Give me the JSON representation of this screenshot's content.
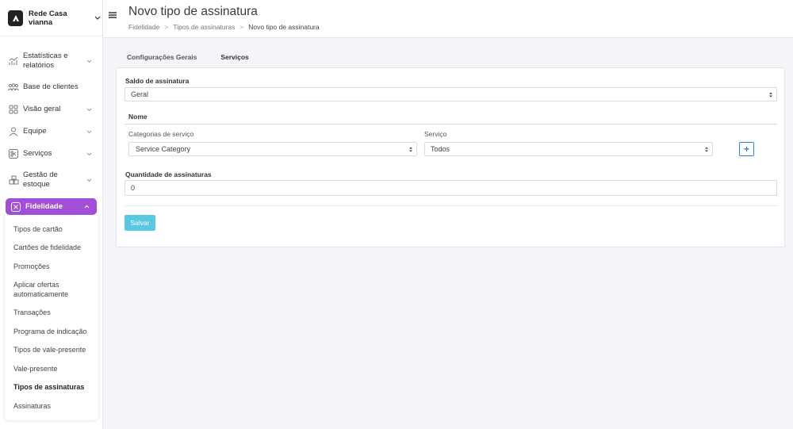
{
  "sidebar": {
    "brand": "Rede Casa vianna",
    "items": [
      {
        "label": "Estatísticas e relatórios"
      },
      {
        "label": "Base de clientes"
      },
      {
        "label": "Visão geral"
      },
      {
        "label": "Equipe"
      },
      {
        "label": "Serviços"
      },
      {
        "label": "Gestão de estoque"
      },
      {
        "label": "Fidelidade"
      }
    ],
    "submenu": [
      "Tipos de cartão",
      "Cartões de fidelidade",
      "Promoções",
      "Aplicar ofertas automaticamente",
      "Transações",
      "Programa de indicação",
      "Tipos de vale-presente",
      "Vale-presente",
      "Tipos de assinaturas",
      "Assinaturas"
    ],
    "active_color": "#a14fd8"
  },
  "header": {
    "title": "Novo tipo de assinatura",
    "breadcrumb": [
      "Fidelidade",
      "Tipos de assinaturas",
      "Novo tipo de assinatura"
    ],
    "sep": ">"
  },
  "tabs": [
    {
      "label": "Configurações Gerais",
      "active": false
    },
    {
      "label": "Serviços",
      "active": true
    }
  ],
  "form": {
    "saldo_label": "Saldo de assinatura",
    "saldo_value": "Geral",
    "nome_label": "Nome",
    "categorias_label": "Categorias de serviço",
    "categorias_value": "Service Category",
    "servico_label": "Serviço",
    "servico_value": "Todos",
    "add_label": "+",
    "quantidade_label": "Quantidade de assinaturas",
    "quantidade_value": "0",
    "save_label": "Salvar"
  },
  "colors": {
    "save_button": "#5bc8e3",
    "plus_button": "#2f7fd8"
  }
}
